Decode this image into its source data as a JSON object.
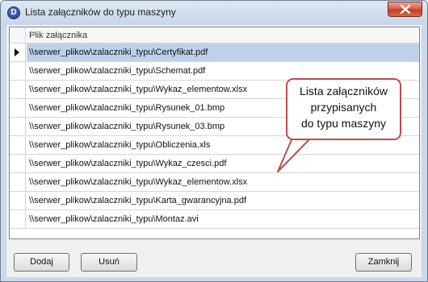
{
  "window": {
    "title": "Lista załączników do typu maszyny",
    "app_icon_glyph": "D"
  },
  "grid": {
    "column_header": "Plik załącznika",
    "selected_index": 0,
    "rows": [
      "\\\\serwer_plikow\\zalaczniki_typu\\Certyfikat.pdf",
      "\\\\serwer_plikow\\zalaczniki_typu\\Schemat.pdf",
      "\\\\serwer_plikow\\zalaczniki_typu\\Wykaz_elementow.xlsx",
      "\\\\serwer_plikow\\zalaczniki_typu\\Rysunek_01.bmp",
      "\\\\serwer_plikow\\zalaczniki_typu\\Rysunek_03.bmp",
      "\\\\serwer_plikow\\zalaczniki_typu\\Obliczenia.xls",
      "\\\\serwer_plikow\\zalaczniki_typu\\Wykaz_czesci.pdf",
      "\\\\serwer_plikow\\zalaczniki_typu\\Wykaz_elementow.xlsx",
      "\\\\serwer_plikow\\zalaczniki_typu\\Karta_gwarancyjna.pdf",
      "\\\\serwer_plikow\\zalaczniki_typu\\Montaz.avi"
    ]
  },
  "callout": {
    "lines": [
      "Lista załączników",
      "przypisanych",
      "do typu maszyny"
    ]
  },
  "buttons": {
    "add": "Dodaj",
    "remove": "Usuń",
    "close": "Zamknij"
  },
  "colors": {
    "selected_row": "#bdd1eb",
    "callout_border": "#bc4b4b",
    "close_button": "#c43a22"
  }
}
